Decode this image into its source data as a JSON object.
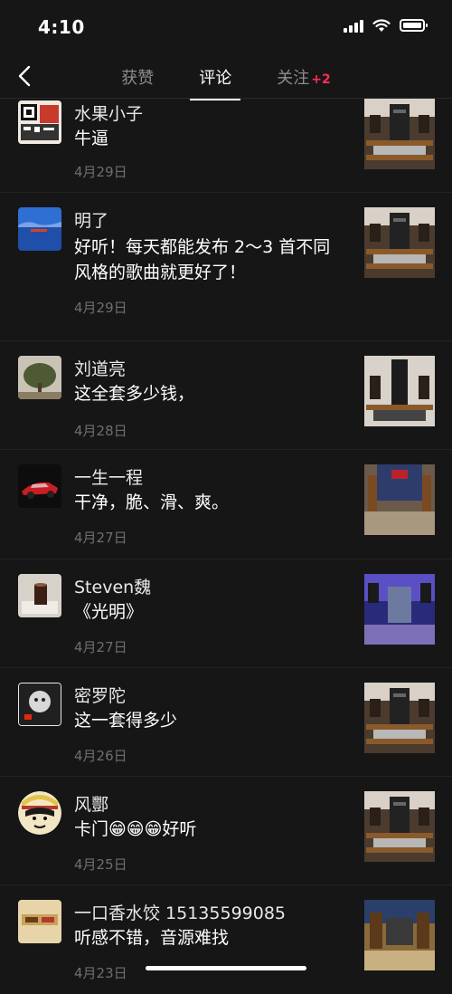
{
  "status": {
    "time": "4:10"
  },
  "nav": {
    "tabs": [
      {
        "label": "获赞"
      },
      {
        "label": "评论"
      },
      {
        "label": "关注",
        "badge": "+2"
      }
    ]
  },
  "comments": [
    {
      "name": "水果小子",
      "text": "牛逼",
      "date": "4月29日"
    },
    {
      "name": "明了",
      "text": "好听！每天都能发布 2～3 首不同风格的歌曲就更好了！",
      "date": "4月29日"
    },
    {
      "name": "刘道亮",
      "text": "这全套多少钱，",
      "date": "4月28日"
    },
    {
      "name": "一生一程",
      "text": "干净，脆、滑、爽。",
      "date": "4月27日"
    },
    {
      "name": "Steven魏",
      "text": "《光明》",
      "date": "4月27日"
    },
    {
      "name": "密罗陀",
      "text": "这一套得多少",
      "date": "4月26日"
    },
    {
      "name": "风酆",
      "text": "卡门😁😁😁好听",
      "date": "4月25日"
    },
    {
      "name": "一口香水饺 15135599085",
      "text": "听感不错，音源难找",
      "date": "4月23日"
    }
  ],
  "colors": {
    "background": "#161617",
    "accent": "#fe2c55",
    "muted": "#6e6e72"
  }
}
